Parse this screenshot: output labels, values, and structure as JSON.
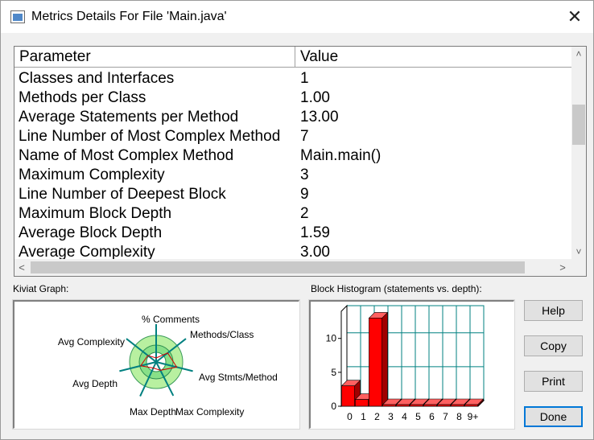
{
  "window": {
    "title": "Metrics Details For File 'Main.java'",
    "close_glyph": "✕"
  },
  "table": {
    "headers": [
      "Parameter",
      "Value"
    ],
    "rows": [
      {
        "parameter": "Classes and Interfaces",
        "value": "1"
      },
      {
        "parameter": "Methods per Class",
        "value": "1.00"
      },
      {
        "parameter": "Average Statements per Method",
        "value": "13.00"
      },
      {
        "parameter": "Line Number of Most Complex Method",
        "value": "7"
      },
      {
        "parameter": "Name of Most Complex Method",
        "value": "Main.main()"
      },
      {
        "parameter": "Maximum Complexity",
        "value": "3"
      },
      {
        "parameter": "Line Number of Deepest Block",
        "value": "9"
      },
      {
        "parameter": "Maximum Block Depth",
        "value": "2"
      },
      {
        "parameter": "Average Block Depth",
        "value": "1.59"
      },
      {
        "parameter": "Average Complexity",
        "value": "3.00"
      }
    ]
  },
  "scrollbars": {
    "up": "˄",
    "down": "˅",
    "left": "<",
    "right": ">"
  },
  "kiviat": {
    "label": "Kiviat Graph:",
    "axes": [
      "% Comments",
      "Methods/Class",
      "Avg Stmts/Method",
      "Max Complexity",
      "Max Depth",
      "Avg Depth",
      "Avg Complexity"
    ]
  },
  "histogram": {
    "label": "Block Histogram (statements vs. depth):"
  },
  "chart_data": {
    "type": "bar",
    "categories": [
      "0",
      "1",
      "2",
      "3",
      "4",
      "5",
      "6",
      "7",
      "8",
      "9+"
    ],
    "values": [
      3,
      1,
      13,
      0,
      0,
      0,
      0,
      0,
      0,
      0
    ],
    "yticks": [
      0,
      5,
      10
    ],
    "ylim": [
      0,
      14
    ],
    "grid": true,
    "bar_color": "#ff0000"
  },
  "buttons": {
    "help": "Help",
    "copy": "Copy",
    "print": "Print",
    "done": "Done"
  }
}
